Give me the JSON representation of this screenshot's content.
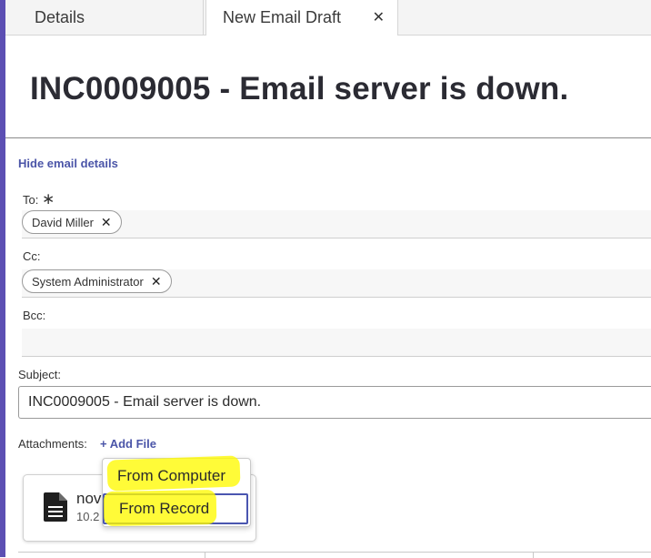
{
  "tabs": [
    {
      "label": "Details"
    },
    {
      "label": "New Email Draft",
      "close_icon": "close-icon"
    }
  ],
  "close_glyph": "✕",
  "title": "INC0009005 - Email server is down.",
  "hide_details_label": "Hide email details",
  "fields": {
    "to": {
      "label": "To:",
      "required_mark": "∗",
      "chips": [
        "David Miller"
      ]
    },
    "cc": {
      "label": "Cc:",
      "chips": [
        "System Administrator"
      ]
    },
    "bcc": {
      "label": "Bcc:",
      "chips": []
    }
  },
  "chip_remove_glyph": "✕",
  "subject": {
    "label": "Subject:",
    "value": "INC0009005 - Email server is down."
  },
  "attachments": {
    "label": "Attachments:",
    "add_file_label": "+ Add File",
    "file": {
      "name": "nov",
      "size": "10.2",
      "icon": "document-icon"
    }
  },
  "add_file_menu": {
    "items": [
      "From Computer",
      "From Record"
    ],
    "focused": "From Record",
    "highlight_color": "#fff500"
  },
  "colors": {
    "accent": "#5c4fb3",
    "link": "#4b55a8"
  }
}
